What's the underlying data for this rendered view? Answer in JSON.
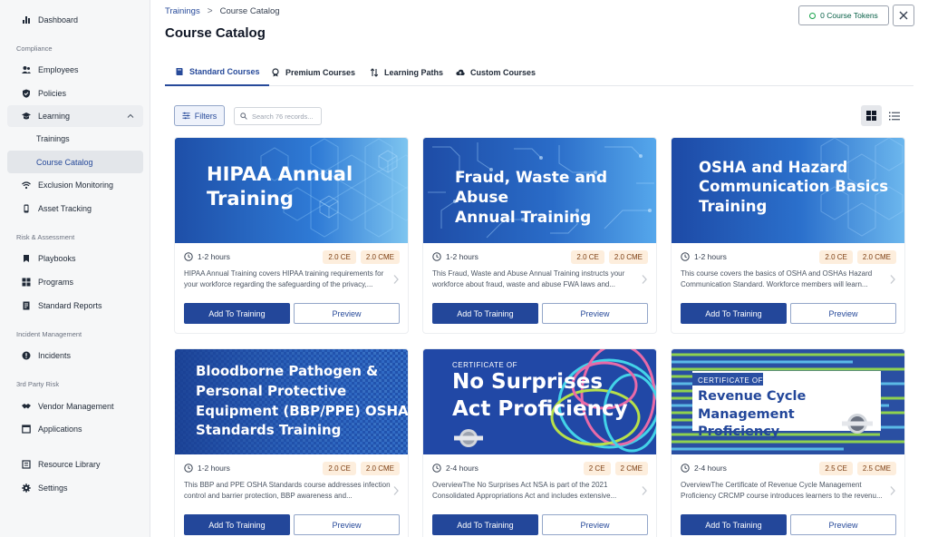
{
  "sidebar": {
    "sections": [
      {
        "label": ""
      },
      {
        "label": "Compliance"
      },
      {
        "label": "Risk & Assessment"
      },
      {
        "label": "Incident Management"
      },
      {
        "label": "3rd Party Risk"
      }
    ],
    "items": {
      "dashboard": "Dashboard",
      "employees": "Employees",
      "policies": "Policies",
      "learning": "Learning",
      "trainings": "Trainings",
      "course_catalog": "Course Catalog",
      "exclusion_monitoring": "Exclusion Monitoring",
      "asset_tracking": "Asset Tracking",
      "playbooks": "Playbooks",
      "programs": "Programs",
      "standard_reports": "Standard Reports",
      "incidents": "Incidents",
      "vendor_management": "Vendor Management",
      "applications": "Applications",
      "resource_library": "Resource Library",
      "settings": "Settings"
    },
    "section_labels": {
      "compliance": "Compliance",
      "risk": "Risk & Assessment",
      "incident": "Incident Management",
      "third_party": "3rd Party Risk"
    }
  },
  "breadcrumb": {
    "parent": "Trainings",
    "separator": ">",
    "current": "Course Catalog"
  },
  "page_title": "Course Catalog",
  "tokens_button": "0 Course Tokens",
  "tabs": {
    "standard": "Standard Courses",
    "premium": "Premium Courses",
    "paths": "Learning Paths",
    "custom": "Custom Courses"
  },
  "toolbar": {
    "filters_label": "Filters",
    "search_placeholder": "Search 76 records..."
  },
  "buttons": {
    "add": "Add To Training",
    "preview": "Preview"
  },
  "courses": [
    {
      "banner_lines": [
        "HIPAA Annual",
        "Training"
      ],
      "hours": "1-2 hours",
      "ce": "2.0 CE",
      "cme": "2.0 CME",
      "description": "HIPAA Annual Training covers HIPAA training requirements for your workforce regarding the safeguarding of the privacy,..."
    },
    {
      "banner_lines": [
        "Fraud, Waste and Abuse",
        "Annual Training"
      ],
      "hours": "1-2 hours",
      "ce": "2.0 CE",
      "cme": "2.0 CME",
      "description": "This Fraud, Waste and Abuse Annual Training instructs your workforce about fraud, waste and abuse FWA laws and..."
    },
    {
      "banner_lines": [
        "OSHA and Hazard",
        "Communication Basics",
        "Training"
      ],
      "hours": "1-2 hours",
      "ce": "2.0 CE",
      "cme": "2.0 CME",
      "description": "This course covers the basics of OSHA and OSHAs Hazard Communication Standard. Workforce members will learn..."
    },
    {
      "banner_lines": [
        "Bloodborne Pathogen &",
        "Personal Protective",
        "Equipment (BBP/PPE) OSHA",
        "Standards Training"
      ],
      "hours": "1-2 hours",
      "ce": "2.0 CE",
      "cme": "2.0 CME",
      "description": "This BBP and PPE OSHA Standards course addresses infection control and barrier protection, BBP awareness and..."
    },
    {
      "certificate_label": "CERTIFICATE OF",
      "banner_lines": [
        "No Surprises",
        "Act Proficiency"
      ],
      "hours": "2-4 hours",
      "ce": "2 CE",
      "cme": "2 CME",
      "description": "OverviewThe No Surprises Act NSA is part of the 2021 Consolidated Appropriations Act and includes extensive..."
    },
    {
      "certificate_label": "CERTIFICATE OF",
      "banner_lines": [
        "Revenue Cycle Management",
        "Proficiency"
      ],
      "hours": "2-4 hours",
      "ce": "2.5 CE",
      "cme": "2.5 CME",
      "description": "OverviewThe Certificate of Revenue Cycle Management Proficiency CRCMP course introduces learners to the revenu..."
    }
  ],
  "colors": {
    "primary": "#23479a",
    "badge_bg": "#fdeedd",
    "badge_text": "#7c3e12",
    "sidebar_bg": "#f6f7f8"
  }
}
